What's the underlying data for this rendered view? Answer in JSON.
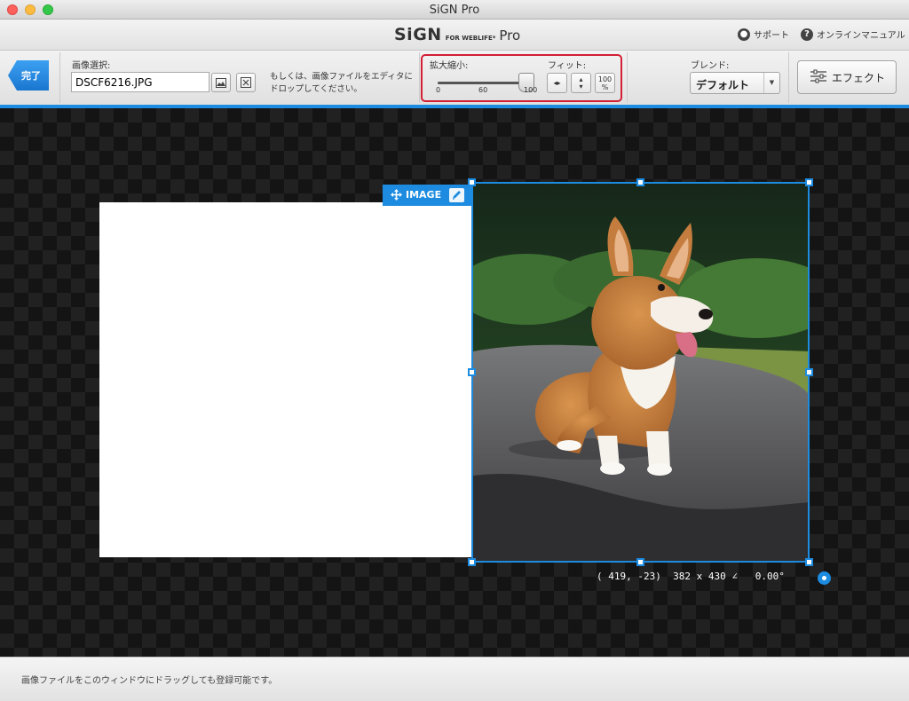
{
  "window": {
    "title": "SiGN Pro"
  },
  "header": {
    "logo_main": "SiGN",
    "logo_for": "FOR WEBLIFE*",
    "logo_pro": "Pro",
    "support_label": "サポート",
    "manual_label": "オンラインマニュアル"
  },
  "toolbar": {
    "done_label": "完了",
    "image_select_label": "画像選択:",
    "file_value": "DSCF6216.JPG",
    "hint_text": "もしくは、画像ファイルをエディタにドロップしてください。",
    "zoom_label": "拡大縮小:",
    "zoom_ticks": [
      "0",
      "60",
      "100"
    ],
    "zoom_value_percent": 100,
    "fit_label": "フィット:",
    "fit_100_label": "100\n%",
    "blend_label": "ブレンド:",
    "blend_value": "デフォルト",
    "effect_label": "エフェクト"
  },
  "canvas": {
    "image_tag_label": "IMAGE",
    "coordinate_readout": "( 419, -23)  382 x 430 ∠   0.00°"
  },
  "status": {
    "text": "画像ファイルをこのウィンドウにドラッグしても登録可能です。"
  },
  "colors": {
    "accent": "#1d8ce0",
    "highlight_border": "#d21f35"
  }
}
